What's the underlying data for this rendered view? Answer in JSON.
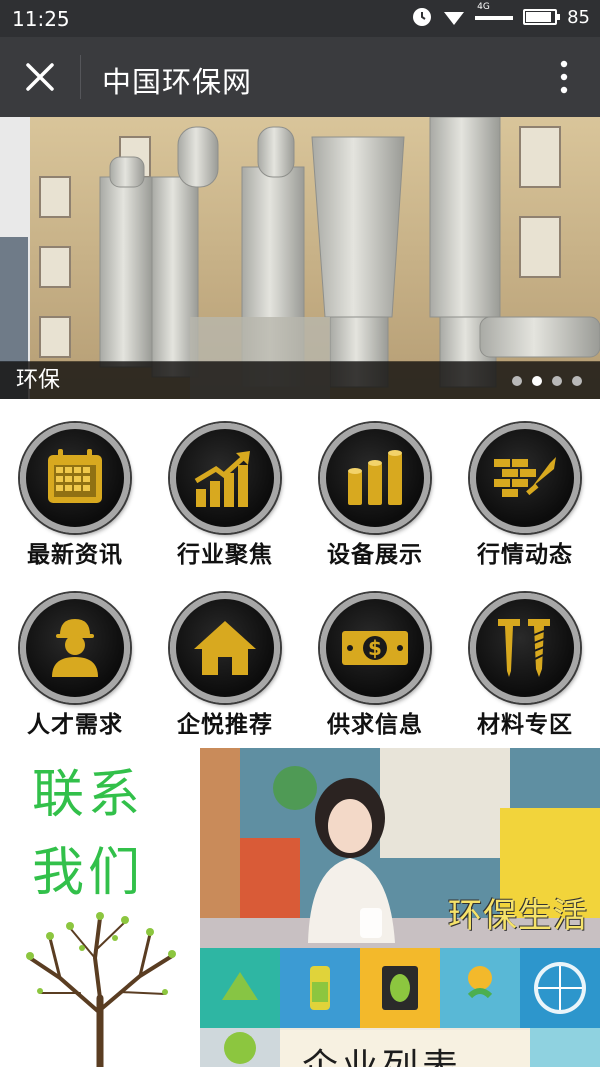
{
  "status_bar": {
    "time": "11:25",
    "network": "4G",
    "battery": "85"
  },
  "title_bar": {
    "title": "中国环保网",
    "close_icon": "close-icon",
    "more_icon": "more-vertical-icon"
  },
  "banner": {
    "caption": "环保",
    "dot_count": 4,
    "active_dot": 1
  },
  "categories": [
    {
      "label": "最新资讯",
      "icon": "calendar-icon"
    },
    {
      "label": "行业聚焦",
      "icon": "growth-chart-icon"
    },
    {
      "label": "设备展示",
      "icon": "cylinders-icon"
    },
    {
      "label": "行情动态",
      "icon": "bricks-trowel-icon"
    },
    {
      "label": "人才需求",
      "icon": "worker-icon"
    },
    {
      "label": "企悦推荐",
      "icon": "house-icon"
    },
    {
      "label": "供求信息",
      "icon": "dollar-bill-icon"
    },
    {
      "label": "材料专区",
      "icon": "nail-screw-icon"
    }
  ],
  "contact": {
    "line1": "联系",
    "line2": "我们"
  },
  "life": {
    "text": "环保生活"
  },
  "enterprise": {
    "text": "企业列表"
  },
  "colors": {
    "gold": "#d8a91f",
    "green": "#32c04a",
    "bar_dark": "#2f3033"
  }
}
